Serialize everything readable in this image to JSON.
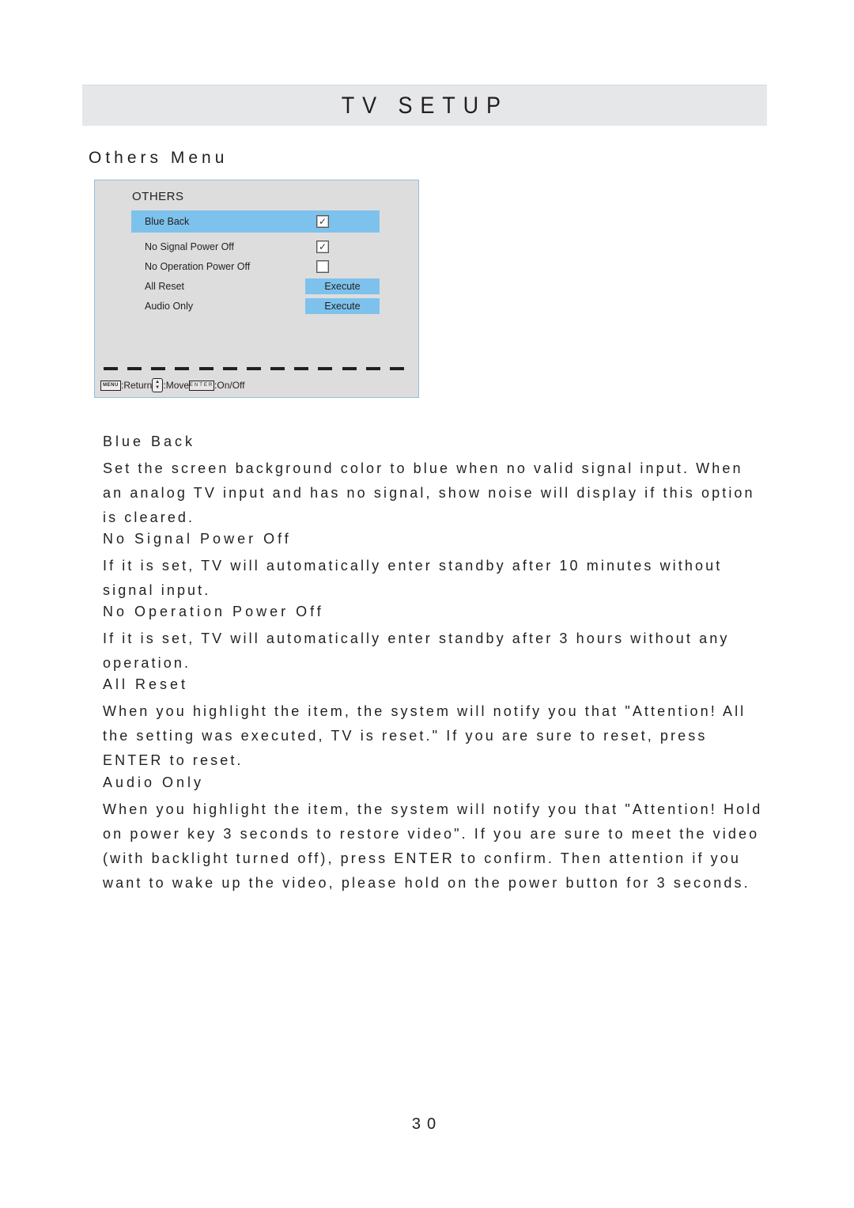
{
  "header": {
    "title": "TV SETUP"
  },
  "section_title": "Others Menu",
  "osd_menu": {
    "heading": "OTHERS",
    "items": [
      {
        "label": "Blue Back",
        "control": "checkbox",
        "checked": true,
        "selected": true,
        "check_glyph": "✓"
      },
      {
        "label": "No Signal Power Off",
        "control": "checkbox",
        "checked": true,
        "selected": false,
        "check_glyph": "✓"
      },
      {
        "label": "No Operation Power Off",
        "control": "checkbox",
        "checked": false,
        "selected": false,
        "check_glyph": ""
      },
      {
        "label": "All Reset",
        "control": "button",
        "button_label": "Execute"
      },
      {
        "label": "Audio Only",
        "control": "button",
        "button_label": "Execute"
      }
    ],
    "help": {
      "menu_key": "MENU",
      "menu_action": ":Return",
      "arrows_key_up": "▲",
      "arrows_key_down": "▼",
      "arrows_action": ":Move",
      "enter_key": "ENTER",
      "enter_action": ":On/Off"
    },
    "colors": {
      "highlight": "#7dc2ec",
      "panel_bg": "#dddddd",
      "panel_border": "#8ebfe3"
    }
  },
  "descriptions": [
    {
      "heading": "Blue Back",
      "text": "Set the screen background color to blue when no valid signal input. When an analog TV input and has no signal, show noise will display if this option is cleared."
    },
    {
      "heading": "No Signal Power Off",
      "text": "If it is set, TV will automatically enter standby after 10 minutes without signal input."
    },
    {
      "heading": "No Operation Power Off",
      "text": "If it is set, TV will automatically enter standby after 3 hours without any operation."
    },
    {
      "heading": "All Reset",
      "text": "When you highlight the item, the system will notify you that \"Attention! All the setting was executed, TV is reset.\" If you are sure to reset, press ENTER to reset."
    },
    {
      "heading": "Audio Only",
      "text": "When you highlight the item, the system will notify you that \"Attention! Hold on power key 3 seconds to restore video\". If you are sure to meet the video (with backlight turned off), press ENTER to confirm. Then attention if you want to wake up the video, please hold on the power button for 3 seconds."
    }
  ],
  "page_number": "30"
}
